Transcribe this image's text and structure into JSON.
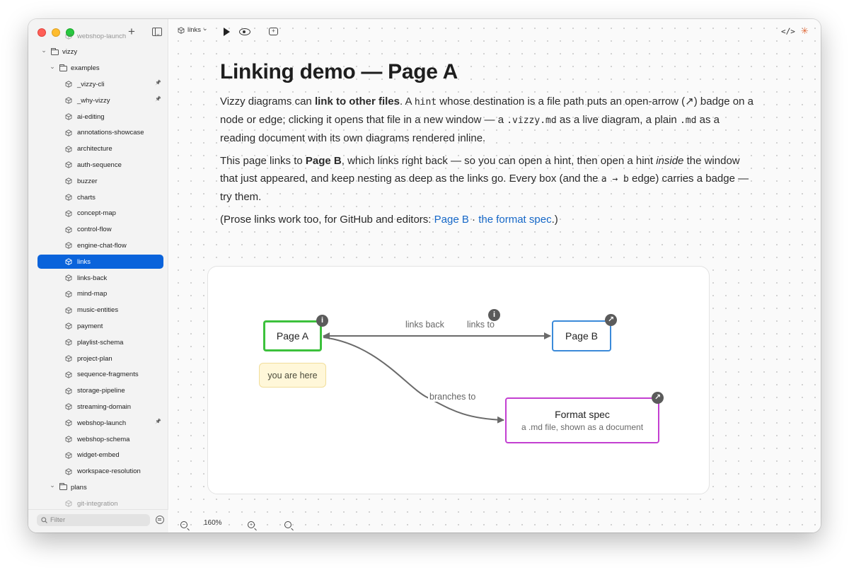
{
  "sidebar": {
    "tree": [
      {
        "label": "webshop-launch",
        "kind": "file",
        "indent": 2,
        "pinned": true,
        "faded": true
      },
      {
        "label": "vizzy",
        "kind": "folder",
        "indent": 0,
        "expanded": true
      },
      {
        "label": "examples",
        "kind": "folder",
        "indent": 1,
        "expanded": true
      },
      {
        "label": "_vizzy-cli",
        "kind": "file",
        "indent": 2,
        "pinned": true
      },
      {
        "label": "_why-vizzy",
        "kind": "file",
        "indent": 2,
        "pinned": true
      },
      {
        "label": "ai-editing",
        "kind": "file",
        "indent": 2
      },
      {
        "label": "annotations-showcase",
        "kind": "file",
        "indent": 2
      },
      {
        "label": "architecture",
        "kind": "file",
        "indent": 2
      },
      {
        "label": "auth-sequence",
        "kind": "file",
        "indent": 2
      },
      {
        "label": "buzzer",
        "kind": "file",
        "indent": 2
      },
      {
        "label": "charts",
        "kind": "file",
        "indent": 2
      },
      {
        "label": "concept-map",
        "kind": "file",
        "indent": 2
      },
      {
        "label": "control-flow",
        "kind": "file",
        "indent": 2
      },
      {
        "label": "engine-chat-flow",
        "kind": "file",
        "indent": 2
      },
      {
        "label": "links",
        "kind": "file",
        "indent": 2,
        "selected": true
      },
      {
        "label": "links-back",
        "kind": "file",
        "indent": 2
      },
      {
        "label": "mind-map",
        "kind": "file",
        "indent": 2
      },
      {
        "label": "music-entities",
        "kind": "file",
        "indent": 2
      },
      {
        "label": "payment",
        "kind": "file",
        "indent": 2
      },
      {
        "label": "playlist-schema",
        "kind": "file",
        "indent": 2
      },
      {
        "label": "project-plan",
        "kind": "file",
        "indent": 2
      },
      {
        "label": "sequence-fragments",
        "kind": "file",
        "indent": 2
      },
      {
        "label": "storage-pipeline",
        "kind": "file",
        "indent": 2
      },
      {
        "label": "streaming-domain",
        "kind": "file",
        "indent": 2
      },
      {
        "label": "webshop-launch",
        "kind": "file",
        "indent": 2,
        "pinned": true
      },
      {
        "label": "webshop-schema",
        "kind": "file",
        "indent": 2
      },
      {
        "label": "widget-embed",
        "kind": "file",
        "indent": 2
      },
      {
        "label": "workspace-resolution",
        "kind": "file",
        "indent": 2
      },
      {
        "label": "plans",
        "kind": "folder",
        "indent": 1,
        "expanded": true
      },
      {
        "label": "git-integration",
        "kind": "file",
        "indent": 2,
        "faded": true
      }
    ],
    "filter_placeholder": "Filter",
    "add_glyph": "+"
  },
  "toolbar": {
    "file_menu_label": "links",
    "chevron_glyph": "⌄",
    "code_glyph": "</>",
    "spark_glyph": "✳"
  },
  "document": {
    "title": "Linking demo — Page A",
    "p1": [
      {
        "t": "Vizzy diagrams can "
      },
      {
        "t": "link to other files",
        "s": "b"
      },
      {
        "t": ". A "
      },
      {
        "t": "hint",
        "s": "code"
      },
      {
        "t": " whose destination is a file path puts an open-arrow (↗) badge on a node or edge; clicking it opens that file in a new window — a "
      },
      {
        "t": ".vizzy.md",
        "s": "code"
      },
      {
        "t": " as a live diagram, a plain "
      },
      {
        "t": ".md",
        "s": "code"
      },
      {
        "t": " as a reading document with its own diagrams rendered inline."
      }
    ],
    "p2": [
      {
        "t": "This page links to "
      },
      {
        "t": "Page B",
        "s": "b"
      },
      {
        "t": ", which links right back — so you can open a hint, then open a hint "
      },
      {
        "t": "inside",
        "s": "i"
      },
      {
        "t": " the window that just appeared, and keep nesting as deep as the links go. Every box (and the "
      },
      {
        "t": "a → b",
        "s": "code"
      },
      {
        "t": " edge) carries a badge — try them."
      }
    ],
    "p3": [
      {
        "t": "(Prose links work too, for GitHub and editors: "
      },
      {
        "t": "Page B",
        "s": "a"
      },
      {
        "t": " · "
      },
      {
        "t": "the format spec",
        "s": "a"
      },
      {
        "t": ".)"
      }
    ]
  },
  "diagram": {
    "node_a": "Page A",
    "node_b": "Page B",
    "node_c_title": "Format spec",
    "node_c_subtitle": "a .md file, shown as a document",
    "note": "you are here",
    "edge_links_back": "links back",
    "edge_links_to": "links to",
    "edge_branches_to": "branches to",
    "info_glyph": "i",
    "link_glyph": "↗",
    "colors": {
      "node_a_border": "#3cc13c",
      "node_b_border": "#3b8ad9",
      "node_c_border": "#c33fd1",
      "edge": "#6a6a6a",
      "note_bg": "#fff7d9"
    }
  },
  "zoom": {
    "level": "160%"
  },
  "colors": {
    "accent": "#0a63db",
    "link": "#1668c8"
  }
}
